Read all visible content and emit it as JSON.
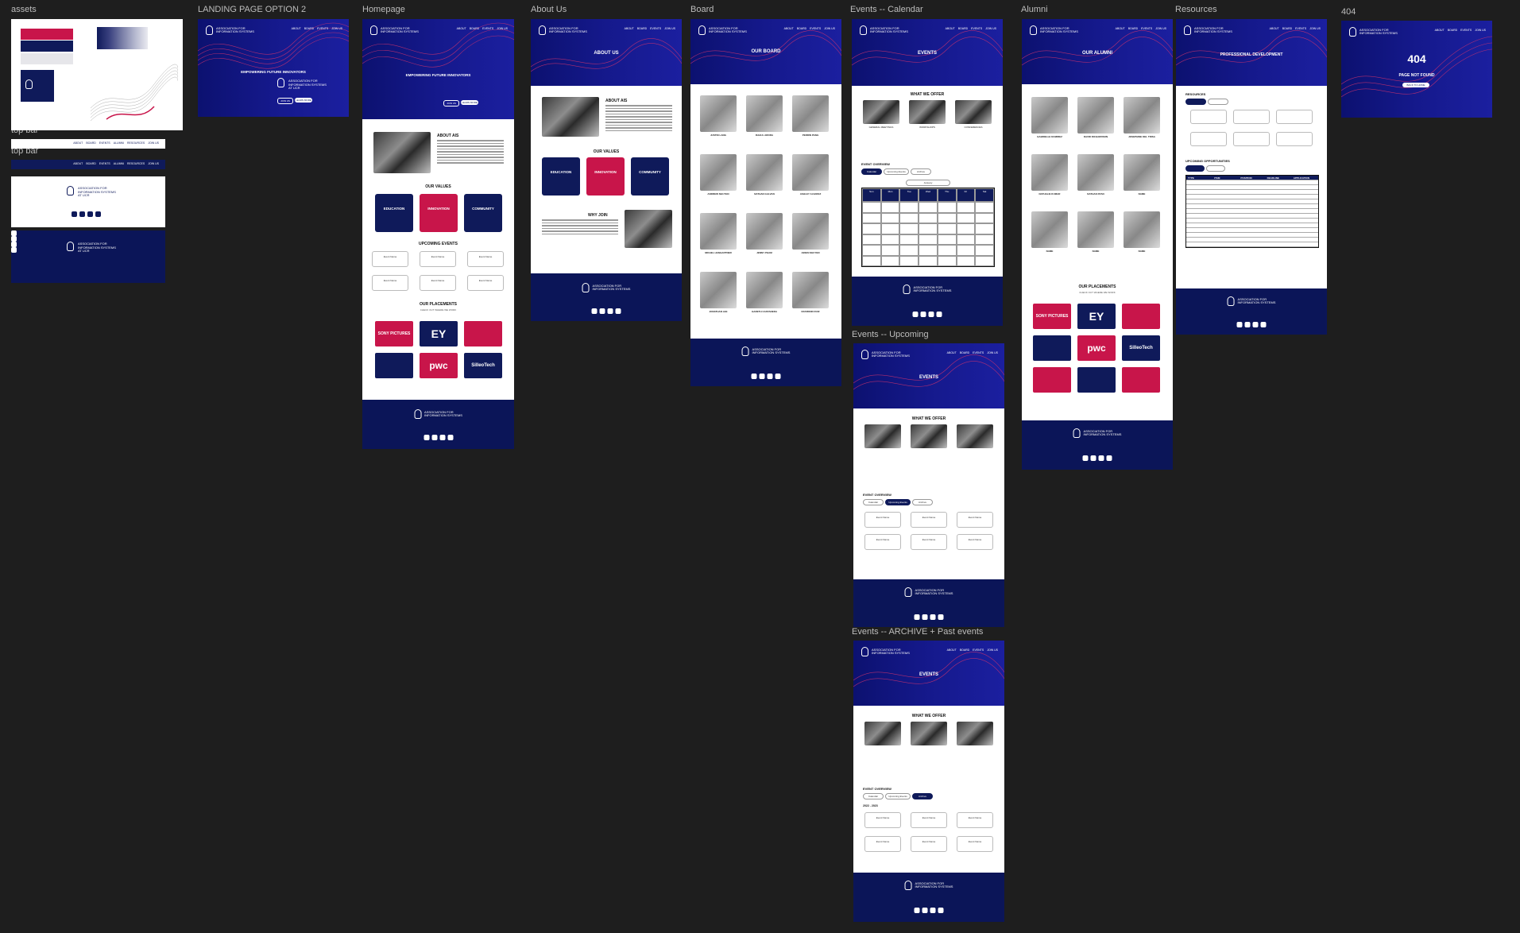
{
  "canvas_bg": "#1e1e1e",
  "labels": {
    "assets": "assets",
    "topbar1": "top bar",
    "topbar2": "top bar",
    "landing": "LANDING PAGE OPTION 2",
    "home": "Homepage",
    "about": "About Us",
    "board": "Board",
    "ev_cal": "Events -- Calendar",
    "ev_up": "Events -- Upcoming",
    "ev_arch": "Events -- ARCHIVE + Past events",
    "alumni": "Alumni",
    "resources": "Resources",
    "notfound": "404"
  },
  "org": {
    "name_lines": [
      "ASSOCIATION FOR",
      "INFORMATION SYSTEMS",
      "AT UCR"
    ]
  },
  "nav_items": [
    "ABOUT",
    "BOARD",
    "EVENTS",
    "ALUMNI",
    "RESOURCES",
    "JOIN US"
  ],
  "landing": {
    "tagline": "EMPOWERING FUTURE INNOVATORS",
    "btn1": "JOIN US",
    "btn2": "LEARN MORE"
  },
  "home": {
    "about_title": "ABOUT AIS",
    "values_title": "OUR VALUES",
    "values": [
      "EDUCATION",
      "INNOVATION",
      "COMMUNITY"
    ],
    "events_title": "UPCOMING EVENTS",
    "event_card": "Event Name",
    "placements_title": "OUR PLACEMENTS",
    "placements_sub": "CHECK OUT WHERE WE WORK",
    "placements": [
      "SONY PICTURES",
      "EY",
      "",
      "",
      "pwc",
      "SilleoTech"
    ]
  },
  "about": {
    "hero": "ABOUT US",
    "about_title": "ABOUT AIS",
    "values_title": "OUR VALUES",
    "values": [
      "EDUCATION",
      "INNOVATION",
      "COMMUNITY"
    ],
    "why_title": "WHY JOIN"
  },
  "board": {
    "hero": "OUR BOARD",
    "members": [
      "JUSTIN LANG",
      "RAHUL ARORA",
      "PERRIN PANG",
      "ANDREW NGUYEN",
      "NATHAN GALVAN",
      "ASHLEY ALVAREZ",
      "MICHEL HANGARTNER",
      "JENNY PHAM",
      "AIDEN NGUYEN",
      "JONATHAN LEE",
      "GARETH CASTANEDA",
      "RAYMOND RUIZ"
    ]
  },
  "events": {
    "hero": "EVENTS",
    "offer_title": "WHAT WE OFFER",
    "offers": [
      "GENERAL MEETINGS",
      "WORKSHOPS",
      "CONFERENCES"
    ],
    "overview": "EVENT OVERVIEW",
    "tabs": [
      "Calendar",
      "Upcoming Events",
      "Archive"
    ],
    "month": "January",
    "days": [
      "Sun",
      "Mon",
      "Tue",
      "Wed",
      "Thu",
      "Fri",
      "Sat"
    ],
    "card": "Event Name",
    "year": "2022 - 2023"
  },
  "alumni": {
    "hero": "OUR ALUMNI",
    "members": [
      "GABRIELLE RAMIREZ",
      "DAVID RICHARDSON",
      "JOSEPHINE DEL TRISA",
      "NATHALIE KUMAR",
      "NATHAN RYAN",
      "NAME",
      "NAME",
      "NAME",
      "NAME"
    ],
    "placements_title": "OUR PLACEMENTS",
    "placements_sub": "CHECK OUT WHERE WE WORK"
  },
  "resources": {
    "hero": "PROFESSIONAL DEVELOPMENT",
    "res_title": "RESOURCES",
    "opp_title": "UPCOMING OPPORTUNITIES",
    "table_head": [
      "TYPE",
      "ITEM",
      "POSITION",
      "DEADLINE",
      "APPLICATION"
    ]
  },
  "notfound": {
    "code": "404",
    "msg": "PAGE NOT FOUND",
    "btn": "BACK TO HOME"
  },
  "colors": {
    "navy": "#0f1a5a",
    "pink": "#c8154a",
    "hero": "#15198c"
  }
}
